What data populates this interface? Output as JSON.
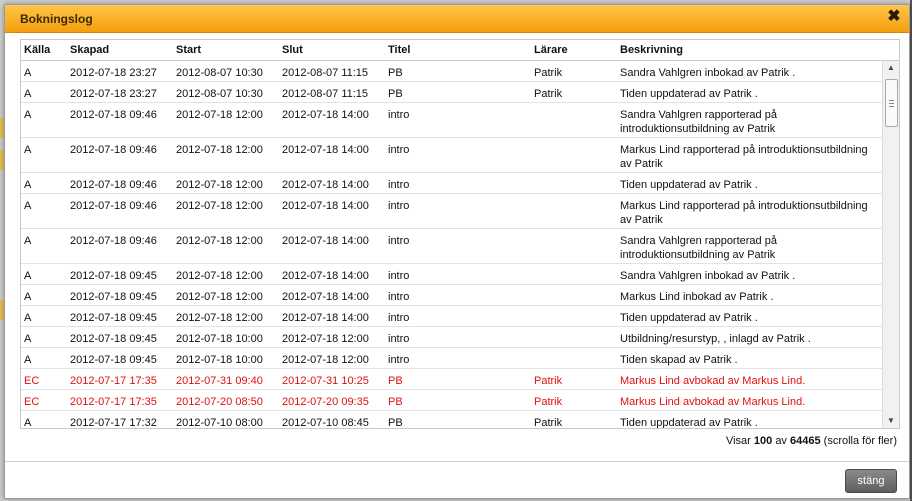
{
  "dialog": {
    "title": "Bokningslog",
    "close_glyph": "✖",
    "close_button_label": "stäng"
  },
  "table": {
    "headers": {
      "kalla": "Källa",
      "skapad": "Skapad",
      "start": "Start",
      "slut": "Slut",
      "titel": "Titel",
      "larare": "Lärare",
      "beskrivning": "Beskrivning"
    },
    "rows": [
      {
        "kalla": "A",
        "skapad": "2012-07-18 23:27",
        "start": "2012-08-07 10:30",
        "slut": "2012-08-07 11:15",
        "titel": "PB",
        "larare": "Patrik",
        "beskrivning": "Sandra Vahlgren inbokad av Patrik ."
      },
      {
        "kalla": "A",
        "skapad": "2012-07-18 23:27",
        "start": "2012-08-07 10:30",
        "slut": "2012-08-07 11:15",
        "titel": "PB",
        "larare": "Patrik",
        "beskrivning": "Tiden uppdaterad av Patrik ."
      },
      {
        "kalla": "A",
        "skapad": "2012-07-18 09:46",
        "start": "2012-07-18 12:00",
        "slut": "2012-07-18 14:00",
        "titel": "intro",
        "larare": "",
        "beskrivning": "Sandra Vahlgren rapporterad på introduktionsutbildning av Patrik"
      },
      {
        "kalla": "A",
        "skapad": "2012-07-18 09:46",
        "start": "2012-07-18 12:00",
        "slut": "2012-07-18 14:00",
        "titel": "intro",
        "larare": "",
        "beskrivning": "Markus Lind rapporterad på introduktionsutbildning av Patrik"
      },
      {
        "kalla": "A",
        "skapad": "2012-07-18 09:46",
        "start": "2012-07-18 12:00",
        "slut": "2012-07-18 14:00",
        "titel": "intro",
        "larare": "",
        "beskrivning": "Tiden uppdaterad av Patrik ."
      },
      {
        "kalla": "A",
        "skapad": "2012-07-18 09:46",
        "start": "2012-07-18 12:00",
        "slut": "2012-07-18 14:00",
        "titel": "intro",
        "larare": "",
        "beskrivning": "Markus Lind rapporterad på introduktionsutbildning av Patrik"
      },
      {
        "kalla": "A",
        "skapad": "2012-07-18 09:46",
        "start": "2012-07-18 12:00",
        "slut": "2012-07-18 14:00",
        "titel": "intro",
        "larare": "",
        "beskrivning": "Sandra Vahlgren rapporterad på introduktionsutbildning av Patrik"
      },
      {
        "kalla": "A",
        "skapad": "2012-07-18 09:45",
        "start": "2012-07-18 12:00",
        "slut": "2012-07-18 14:00",
        "titel": "intro",
        "larare": "",
        "beskrivning": "Sandra Vahlgren inbokad av Patrik ."
      },
      {
        "kalla": "A",
        "skapad": "2012-07-18 09:45",
        "start": "2012-07-18 12:00",
        "slut": "2012-07-18 14:00",
        "titel": "intro",
        "larare": "",
        "beskrivning": "Markus Lind inbokad av Patrik ."
      },
      {
        "kalla": "A",
        "skapad": "2012-07-18 09:45",
        "start": "2012-07-18 12:00",
        "slut": "2012-07-18 14:00",
        "titel": "intro",
        "larare": "",
        "beskrivning": "Tiden uppdaterad av Patrik ."
      },
      {
        "kalla": "A",
        "skapad": "2012-07-18 09:45",
        "start": "2012-07-18 10:00",
        "slut": "2012-07-18 12:00",
        "titel": "intro",
        "larare": "",
        "beskrivning": "Utbildning/resurstyp, , inlagd av Patrik ."
      },
      {
        "kalla": "A",
        "skapad": "2012-07-18 09:45",
        "start": "2012-07-18 10:00",
        "slut": "2012-07-18 12:00",
        "titel": "intro",
        "larare": "",
        "beskrivning": "Tiden skapad av Patrik ."
      },
      {
        "kalla": "EC",
        "skapad": "2012-07-17 17:35",
        "start": "2012-07-31 09:40",
        "slut": "2012-07-31 10:25",
        "titel": "PB",
        "larare": "Patrik",
        "beskrivning": "Markus Lind avbokad av Markus Lind."
      },
      {
        "kalla": "EC",
        "skapad": "2012-07-17 17:35",
        "start": "2012-07-20 08:50",
        "slut": "2012-07-20 09:35",
        "titel": "PB",
        "larare": "Patrik",
        "beskrivning": "Markus Lind avbokad av Markus Lind."
      },
      {
        "kalla": "A",
        "skapad": "2012-07-17 17:32",
        "start": "2012-07-10 08:00",
        "slut": "2012-07-10 08:45",
        "titel": "PB",
        "larare": "Patrik",
        "beskrivning": "Tiden uppdaterad av Patrik ."
      }
    ]
  },
  "footer": {
    "prefix": "Visar",
    "shown": "100",
    "of": "av",
    "total": "64465",
    "suffix": "(scrolla för fler)"
  },
  "colors": {
    "title_bar": "#f59f0e",
    "highlight_row_text": "#e01010"
  }
}
